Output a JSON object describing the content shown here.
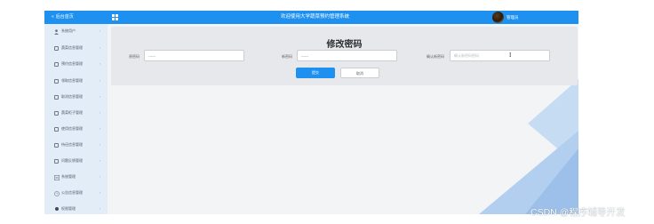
{
  "sidebar": {
    "back_label": "后台首页",
    "items": [
      {
        "label": "系统用户",
        "icon": "user-icon"
      },
      {
        "label": "蔬菜信息管理",
        "icon": "square-icon"
      },
      {
        "label": "预约信息管理",
        "icon": "square-icon"
      },
      {
        "label": "领取信息管理",
        "icon": "square-icon"
      },
      {
        "label": "取消信息管理",
        "icon": "square-icon"
      },
      {
        "label": "蔬菜柜子管理",
        "icon": "square-icon"
      },
      {
        "label": "使用信息管理",
        "icon": "square-icon"
      },
      {
        "label": "待还信息管理",
        "icon": "square-icon"
      },
      {
        "label": "问题反馈管理",
        "icon": "square-icon"
      },
      {
        "label": "系统管理",
        "icon": "list-icon"
      },
      {
        "label": "公告信息管理",
        "icon": "clock-icon"
      },
      {
        "label": "权限管理",
        "icon": "dot-icon"
      }
    ]
  },
  "topbar": {
    "title": "欢迎使用大学蔬菜预约管理系统",
    "username": "管理员"
  },
  "form": {
    "title": "修改密码",
    "old_password_label": "原密码",
    "old_password_value": "------",
    "new_password_label": "新密码",
    "new_password_value": "------",
    "confirm_label": "确认新密码",
    "confirm_placeholder": "确认新密码密码",
    "submit_label": "提交",
    "cancel_label": "取消"
  },
  "watermark": "CSDN @程序辅导开发",
  "colors": {
    "primary": "#1e90ef",
    "sidebar_bg": "#e3edf7",
    "content_bg": "#f3f4f6"
  }
}
